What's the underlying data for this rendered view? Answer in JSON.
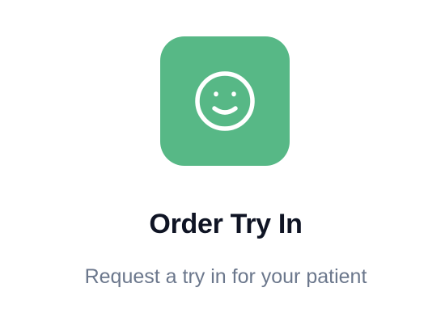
{
  "card": {
    "icon": "smiley-face-icon",
    "accent_color": "#57b886",
    "title": "Order Try In",
    "subtitle": "Request a try in for your patient"
  }
}
